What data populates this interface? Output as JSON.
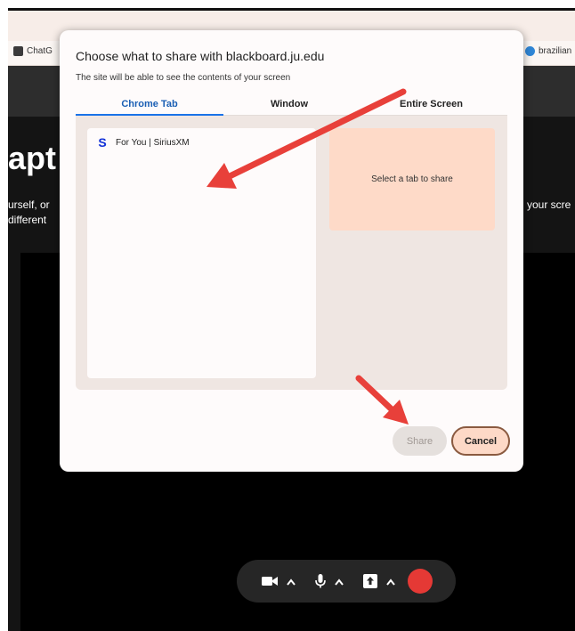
{
  "bookmarks": [
    {
      "label": "ChatG",
      "icon": "chatgpt-icon"
    },
    {
      "label": "brazilian",
      "icon": "search-bubble-icon"
    }
  ],
  "background_page": {
    "heading": "apt",
    "left_lines": [
      "urself, or",
      "different"
    ],
    "right_line": "your scre"
  },
  "dialog": {
    "title": "Choose what to share with blackboard.ju.edu",
    "subtitle": "The site will be able to see the contents of your screen",
    "tabs": [
      {
        "label": "Chrome Tab",
        "active": true
      },
      {
        "label": "Window",
        "active": false
      },
      {
        "label": "Entire Screen",
        "active": false
      }
    ],
    "tab_items": [
      {
        "label": "For You | SiriusXM",
        "icon": "siriusxm-icon"
      }
    ],
    "preview_text": "Select a tab to share",
    "share_label": "Share",
    "cancel_label": "Cancel"
  },
  "controls": {
    "icons": [
      "camera-icon",
      "chevron-up-icon",
      "microphone-icon",
      "chevron-up-icon",
      "share-screen-icon",
      "chevron-up-icon",
      "record-icon"
    ]
  },
  "colors": {
    "accent_tab": "#1a73e8",
    "cancel_bg": "#fdd9c7",
    "preview_bg": "#fedac8",
    "record": "#e53935",
    "annotation_arrow": "#e8403a"
  }
}
